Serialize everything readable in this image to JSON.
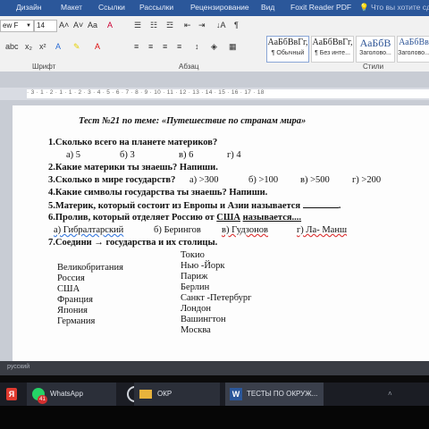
{
  "menu": {
    "tabs": [
      "Дизайн",
      "Макет",
      "Ссылки",
      "Рассылки",
      "Рецензирование",
      "Вид",
      "Foxit Reader PDF"
    ],
    "search_placeholder": "Что вы хотите сде"
  },
  "ribbon": {
    "font_name": "ew F",
    "font_size": "14",
    "group_font": "Шрифт",
    "group_paragraph": "Абзац",
    "group_styles": "Стили",
    "styles": [
      {
        "preview": "АаБбВвГг,",
        "name": "¶ Обычный"
      },
      {
        "preview": "АаБбВвГг,",
        "name": "¶ Без инте..."
      },
      {
        "preview": "АаБбВ",
        "name": "Заголово..."
      },
      {
        "preview": "АаБбВв",
        "name": "Заголово..."
      }
    ]
  },
  "ruler": {
    "numbers": "· 3 · 1 · 2 · 1 · 1 · 2 · 3 · 4 · 5 · 6 · 7 · 8 · 9 · 10 · 11 · 12 · 13 · 14 · 15 · 16 · 17 · 18"
  },
  "document": {
    "title": "Тест №21 по теме: «Путешествие по странам мира»",
    "q1": "1.Сколько всего на планете материков?",
    "q1_options": [
      "а) 5",
      "б) 3",
      "в) 6",
      "г) 4"
    ],
    "q2": "2.Какие материки ты знаешь? Напиши.",
    "q3": "3.Сколько в мире государств?",
    "q3_options": [
      "а) >300",
      "б) >100",
      "в) >500",
      "г) >200"
    ],
    "q4": "4.Какие символы государства ты знаешь? Напиши.",
    "q5": "5.Материк, который состоит из Европы и Азии называется",
    "q5_end": ".",
    "q6_start": "6.Пролив, который отделяет Россию от",
    "q6_link": "США",
    "q6_end": "называется....",
    "q6_options": [
      "а) Гибралтарский",
      "б) Берингов",
      "в) Гудзонов",
      "г) Ла- Манш"
    ],
    "q7_start": "7.Соедини",
    "q7_arrow": "→",
    "q7_end": "государства и их столицы.",
    "countries": [
      "Великобритания",
      "Россия",
      "США",
      "Франция",
      "Япония",
      "Германия"
    ],
    "capitals": [
      "Токио",
      "Нью -Йорк",
      "Париж",
      "Берлин",
      "Санкт -Петербург",
      "Лондон",
      "Вашингтон",
      "Москва"
    ]
  },
  "status": {
    "language": "русский"
  },
  "taskbar": {
    "items": [
      "WhatsApp",
      "ОКР",
      "ТЕСТЫ ПО ОКРУЖ..."
    ],
    "whatsapp_badge": "41"
  }
}
